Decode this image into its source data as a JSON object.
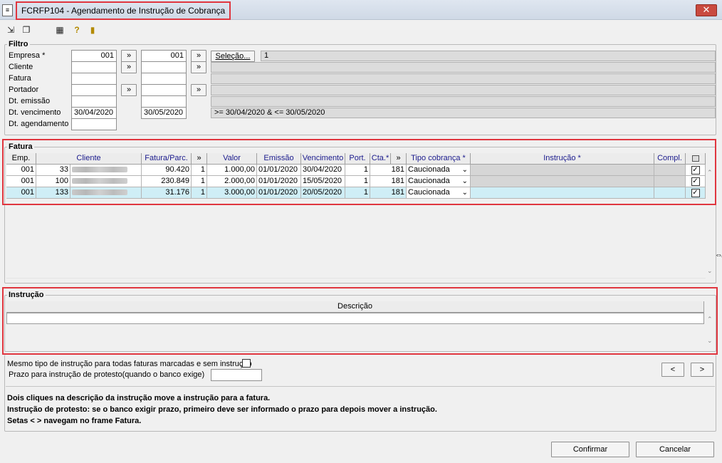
{
  "window": {
    "title": "FCRFP104 - Agendamento de Instrução de Cobrança",
    "close_glyph": "✕"
  },
  "filter": {
    "title": "Filtro",
    "labels": {
      "empresa": "Empresa *",
      "cliente": "Cliente",
      "fatura": "Fatura",
      "portador": "Portador",
      "dt_emissao": "Dt. emissão",
      "dt_vencimento": "Dt. vencimento",
      "dt_agendamento": "Dt. agendamento"
    },
    "empresa_from": "001",
    "empresa_to": "001",
    "selecao_label": "Seleção...",
    "empresa_desc": "1",
    "venc_from": "30/04/2020",
    "venc_to": "30/05/2020",
    "venc_desc": ">= 30/04/2020 & <= 30/05/2020",
    "range_glyph": "»"
  },
  "fatura": {
    "title": "Fatura",
    "headers": [
      "Emp.",
      "Cliente",
      "Fatura/Parc.",
      "»",
      "Valor",
      "Emissão",
      "Vencimento",
      "Port.",
      "Cta.*",
      "»",
      "Tipo cobrança *",
      "Instrução *",
      "Compl."
    ],
    "rows": [
      {
        "emp": "001",
        "cliente_cod": "33",
        "fatura": "90.420",
        "parc": "1",
        "valor": "1.000,00",
        "emissao": "01/01/2020",
        "vencimento": "30/04/2020",
        "port": "1",
        "cta": "181",
        "tipo": "Caucionada",
        "checked": true
      },
      {
        "emp": "001",
        "cliente_cod": "100",
        "fatura": "230.849",
        "parc": "1",
        "valor": "2.000,00",
        "emissao": "01/01/2020",
        "vencimento": "15/05/2020",
        "port": "1",
        "cta": "181",
        "tipo": "Caucionada",
        "checked": true
      },
      {
        "emp": "001",
        "cliente_cod": "133",
        "fatura": "31.176",
        "parc": "1",
        "valor": "3.000,00",
        "emissao": "01/01/2020",
        "vencimento": "20/05/2020",
        "port": "1",
        "cta": "181",
        "tipo": "Caucionada",
        "checked": true
      }
    ]
  },
  "instrucao": {
    "title": "Instrução",
    "header": "Descrição"
  },
  "options": {
    "mesmo_tipo_label": "Mesmo tipo de instrução para todas faturas marcadas e sem instrução",
    "prazo_label": "Prazo para instrução de protesto(quando o banco exige)",
    "prev_label": "<",
    "next_label": ">"
  },
  "notes": [
    "Dois cliques na descrição da instrução move a instrução para a fatura.",
    "Instrução de protesto: se o banco exigir prazo, primeiro deve ser informado o prazo para depois mover a instrução.",
    "Setas < > navegam no frame Fatura."
  ],
  "footer": {
    "confirm_label": "Confirmar",
    "cancel_label": "Cancelar"
  },
  "colors": {
    "highlight": "#e0363f",
    "selected_row": "#cfeef6",
    "header_text": "#1a1a8c"
  }
}
